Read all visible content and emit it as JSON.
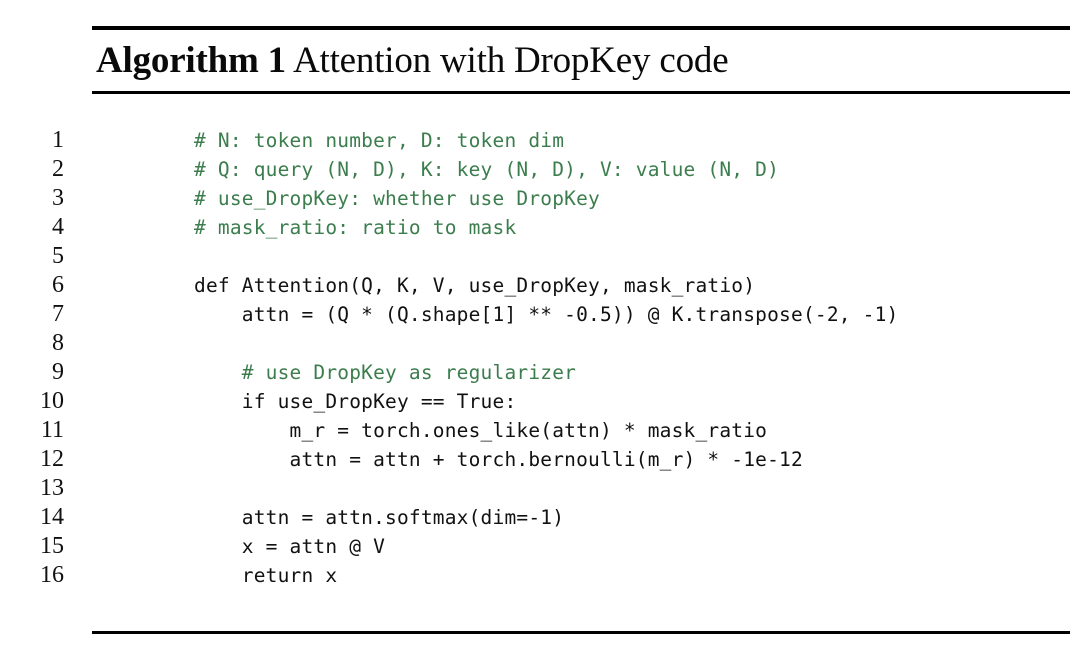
{
  "document": {
    "kind": "algorithm-float",
    "title": {
      "keyword": "Algorithm 1",
      "caption": "Attention with DropKey code",
      "full": "Algorithm 1 Attention with DropKey code"
    },
    "colors": {
      "text": "#111111",
      "comment_green": "#3c7d4e",
      "rule": "#000000",
      "background": "#ffffff"
    },
    "code": {
      "language": "python",
      "line_count": 16,
      "lines": [
        {
          "no": "1",
          "text": "# N: token number, D: token dim",
          "kind": "comment"
        },
        {
          "no": "2",
          "text": "# Q: query (N, D), K: key (N, D), V: value (N, D)",
          "kind": "comment"
        },
        {
          "no": "3",
          "text": "# use_DropKey: whether use DropKey",
          "kind": "comment"
        },
        {
          "no": "4",
          "text": "# mask_ratio: ratio to mask",
          "kind": "comment"
        },
        {
          "no": "5",
          "text": "",
          "kind": "blank"
        },
        {
          "no": "6",
          "text": "def Attention(Q, K, V, use_DropKey, mask_ratio)",
          "kind": "code"
        },
        {
          "no": "7",
          "text": "    attn = (Q * (Q.shape[1] ** -0.5)) @ K.transpose(-2, -1)",
          "kind": "code"
        },
        {
          "no": "8",
          "text": "",
          "kind": "blank"
        },
        {
          "no": "9",
          "text": "    # use DropKey as regularizer",
          "kind": "comment"
        },
        {
          "no": "10",
          "text": "    if use_DropKey == True:",
          "kind": "code"
        },
        {
          "no": "11",
          "text": "        m_r = torch.ones_like(attn) * mask_ratio",
          "kind": "code"
        },
        {
          "no": "12",
          "text": "        attn = attn + torch.bernoulli(m_r) * -1e-12",
          "kind": "code"
        },
        {
          "no": "13",
          "text": "",
          "kind": "blank"
        },
        {
          "no": "14",
          "text": "    attn = attn.softmax(dim=-1)",
          "kind": "code"
        },
        {
          "no": "15",
          "text": "    x = attn @ V",
          "kind": "code"
        },
        {
          "no": "16",
          "text": "    return x",
          "kind": "code"
        }
      ]
    }
  }
}
